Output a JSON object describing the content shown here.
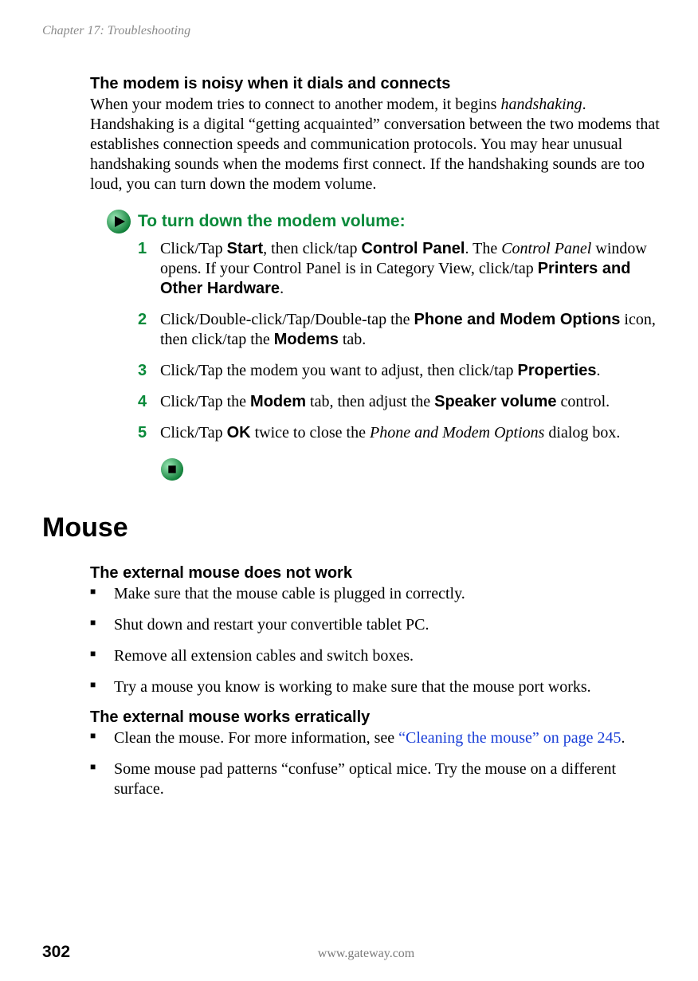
{
  "chapter_header": "Chapter 17: Troubleshooting",
  "modem": {
    "title": "The modem is noisy when it dials and connects",
    "p1_a": "When your modem tries to connect to another modem, it begins ",
    "p1_hs": "handshaking",
    "p1_b": ". Handshaking is a digital “getting acquainted” conversation between the two modems that establishes connection speeds and communication protocols. You may hear unusual handshaking sounds when the modems first connect. If the handshaking sounds are too loud, you can turn down the modem volume."
  },
  "procedure": {
    "title": "To turn down the modem volume:",
    "steps": {
      "s1": {
        "n": "1",
        "a": "Click/Tap ",
        "start": "Start",
        "b": ", then click/tap ",
        "cp": "Control Panel",
        "c": ". The ",
        "cpi": "Control Panel",
        "d": " window opens. If your Control Panel is in Category View, click/tap ",
        "printers": "Printers and Other Hardware",
        "e": "."
      },
      "s2": {
        "n": "2",
        "a": "Click/Double-click/Tap/Double-tap the ",
        "pmo": "Phone and Modem Options",
        "b": " icon, then click/tap the ",
        "modems": "Modems",
        "c": " tab."
      },
      "s3": {
        "n": "3",
        "a": "Click/Tap the modem you want to adjust, then click/tap ",
        "props": "Properties",
        "b": "."
      },
      "s4": {
        "n": "4",
        "a": "Click/Tap the ",
        "modem": "Modem",
        "b": " tab, then adjust the ",
        "speaker": "Speaker volume",
        "c": " control."
      },
      "s5": {
        "n": "5",
        "a": "Click/Tap ",
        "ok": "OK",
        "b": " twice to close the ",
        "pmo": "Phone and Modem Options",
        "c": " dialog box."
      }
    }
  },
  "mouse": {
    "heading": "Mouse",
    "sec1": {
      "title": "The external mouse does not work",
      "b1": "Make sure that the mouse cable is plugged in correctly.",
      "b2": "Shut down and restart your convertible tablet PC.",
      "b3": "Remove all extension cables and switch boxes.",
      "b4": "Try a mouse you know is working to make sure that the mouse port works."
    },
    "sec2": {
      "title": "The external mouse works erratically",
      "b1a": "Clean the mouse. For more information, see ",
      "b1link": "“Cleaning the mouse” on page 245",
      "b1b": ".",
      "b2": "Some mouse pad patterns “confuse” optical mice. Try the mouse on a different surface."
    }
  },
  "footer": {
    "page": "302",
    "url": "www.gateway.com"
  }
}
